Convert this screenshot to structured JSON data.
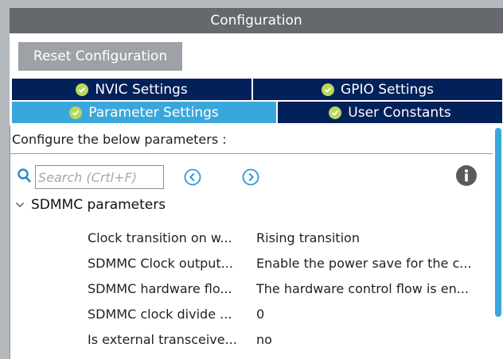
{
  "title": "Configuration",
  "reset_button": "Reset Configuration",
  "tabs": [
    {
      "label": "NVIC Settings"
    },
    {
      "label": "GPIO Settings"
    },
    {
      "label": "Parameter Settings"
    },
    {
      "label": "User Constants"
    }
  ],
  "active_tab": "Parameter Settings",
  "description": "Configure the below parameters :",
  "search": {
    "placeholder": "Search (Crtl+F)",
    "value": ""
  },
  "section": {
    "label": "SDMMC parameters"
  },
  "params": [
    {
      "name": "Clock transition on w...",
      "value": "Rising transition"
    },
    {
      "name": "SDMMC Clock output...",
      "value": "Enable the power save for the c..."
    },
    {
      "name": "SDMMC hardware flo...",
      "value": "The hardware control flow is en..."
    },
    {
      "name": "SDMMC clock divide ...",
      "value": "0"
    },
    {
      "name": "Is external transceive...",
      "value": "no"
    }
  ],
  "icons": {
    "check": "check-circle-icon",
    "search": "search-icon",
    "prev": "chevron-left-circle-icon",
    "next": "chevron-right-circle-icon",
    "info": "info-icon",
    "expand": "chevron-down-icon"
  },
  "colors": {
    "title_bar": "#65696d",
    "tab_dark": "#02205a",
    "tab_active": "#3aa7dc",
    "check": "#b7d95a",
    "scroll_thumb": "#3aa7dc"
  }
}
